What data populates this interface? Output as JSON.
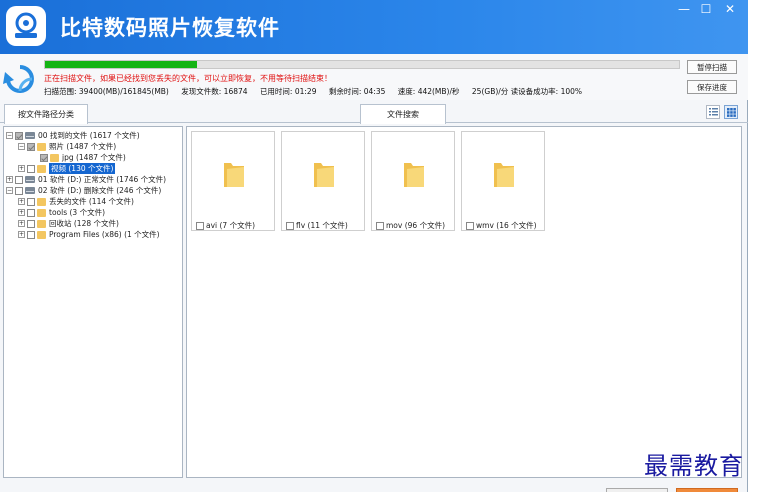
{
  "app": {
    "title": "比特数码照片恢复软件"
  },
  "window_controls": {
    "minimize": "—",
    "maximize": "☐",
    "close": "✕"
  },
  "scan": {
    "progress_fraction": 0.239,
    "message": "正在扫描文件，如果已经找到您丢失的文件，可以立即恢复，不用等待扫描结束！",
    "range_label": "扫描范围: 39400(MB)/161845(MB)",
    "found_label": "发现文件数: 16874",
    "elapsed_label": "已用时间: 01:29",
    "remaining_label": "剩余时间: 04:35",
    "speed_label": "速度: 442(MB)/秒",
    "read_label": "25(GB)/分 读设备成功率: 100%"
  },
  "buttons": {
    "pause": "暂停扫描",
    "save": "保存进度"
  },
  "tabs": {
    "by_path": "按文件路径分类",
    "search": "文件搜索"
  },
  "tree": [
    {
      "label": "00 找到的文件 (1617 个文件)"
    },
    {
      "label": "照片   (1487 个文件)"
    },
    {
      "label": "jpg    (1487 个文件)"
    },
    {
      "label": "视频   (130 个文件)"
    },
    {
      "label": "01 软件 (D:) 正常文件 (1746 个文件)"
    },
    {
      "label": "02 软件 (D:) 删除文件 (246 个文件)"
    },
    {
      "label": "丢失的文件   (114 个文件)"
    },
    {
      "label": "tools    (3 个文件)"
    },
    {
      "label": "回收站    (128 个文件)"
    },
    {
      "label": "Program Files (x86)   (1 个文件)"
    }
  ],
  "folders": [
    {
      "label": "avi (7 个文件)"
    },
    {
      "label": "flv (11 个文件)"
    },
    {
      "label": "mov (96 个文件)"
    },
    {
      "label": "wmv (16 个文件)"
    }
  ],
  "watermark": "最需教育",
  "colors": {
    "title_bar": "#2b86ea",
    "progress": "#14b414",
    "message": "#e01010",
    "selection": "#1466d0",
    "folder": "#f3c660"
  }
}
